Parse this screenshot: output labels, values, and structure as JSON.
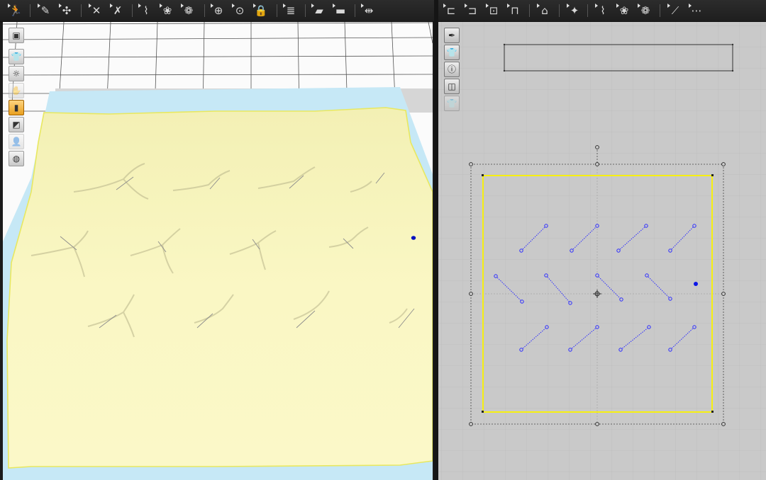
{
  "toolbar_left": {
    "tools": [
      {
        "name": "simulation-icon",
        "glyph": "🏃"
      },
      {
        "name": "select-mesh-icon",
        "glyph": "✎"
      },
      {
        "name": "pin-icon",
        "glyph": "✣"
      },
      {
        "name": "tack-icon",
        "glyph": "✕"
      },
      {
        "name": "tack-arrange-icon",
        "glyph": "✗"
      },
      {
        "name": "fold-icon",
        "glyph": "⌇"
      },
      {
        "name": "fold-arrange-icon",
        "glyph": "❀"
      },
      {
        "name": "shirt-fold-icon",
        "glyph": "❁"
      },
      {
        "name": "button-icon",
        "glyph": "⊕"
      },
      {
        "name": "buttonhole-icon",
        "glyph": "⊙"
      },
      {
        "name": "button-lock-icon",
        "glyph": "🔒"
      },
      {
        "name": "zipper-icon",
        "glyph": "≣"
      },
      {
        "name": "puckering-icon",
        "glyph": "▰"
      },
      {
        "name": "thickness-icon",
        "glyph": "▬"
      },
      {
        "name": "measure-icon",
        "glyph": "⇹"
      }
    ]
  },
  "toolbar_right": {
    "tools": [
      {
        "name": "seam-icon",
        "glyph": "⊏"
      },
      {
        "name": "segment-seam-icon",
        "glyph": "⊐"
      },
      {
        "name": "free-seam-icon",
        "glyph": "⊡"
      },
      {
        "name": "tack-on-avatar-icon",
        "glyph": "⊓"
      },
      {
        "name": "steam-iron-icon",
        "glyph": "⌂"
      },
      {
        "name": "topstitch-icon",
        "glyph": "✦"
      },
      {
        "name": "fold-pattern-icon",
        "glyph": "⌇"
      },
      {
        "name": "fold-arrange-2d-icon",
        "glyph": "❀"
      },
      {
        "name": "shirring-icon",
        "glyph": "❁"
      },
      {
        "name": "internal-line-icon",
        "glyph": "⟋"
      },
      {
        "name": "dart-line-icon",
        "glyph": "⋯"
      }
    ]
  },
  "view3d": {
    "tools": [
      {
        "name": "avatar-display-icon",
        "glyph": "▣",
        "active": false,
        "dimmed": false
      },
      {
        "name": "garment-display-icon",
        "glyph": "👕",
        "active": false,
        "dimmed": false
      },
      {
        "name": "pins-display-icon",
        "glyph": "☼",
        "active": false,
        "dimmed": false
      },
      {
        "name": "shading-icon",
        "glyph": "✋",
        "active": false,
        "dimmed": true
      },
      {
        "name": "texture-icon",
        "glyph": "▮",
        "active": true,
        "dimmed": false
      },
      {
        "name": "wireframe-icon",
        "glyph": "◩",
        "active": false,
        "dimmed": false
      },
      {
        "name": "avatar-silhouette-icon",
        "glyph": "👤",
        "active": false,
        "dimmed": true
      },
      {
        "name": "grid-globe-icon",
        "glyph": "◍",
        "active": false,
        "dimmed": false
      }
    ],
    "fabric_color": "#f9f6bf",
    "floor_color": "#c6e8f6",
    "outline_color": "#e8e860",
    "tack_lines": 14
  },
  "view2d": {
    "tools": [
      {
        "name": "brush-icon",
        "glyph": "✒",
        "dimmed": false
      },
      {
        "name": "pattern-display-icon",
        "glyph": "👕",
        "dimmed": false
      },
      {
        "name": "info-icon",
        "glyph": "ⓘ",
        "dimmed": false
      },
      {
        "name": "texture-2d-icon",
        "glyph": "◫",
        "dimmed": false
      },
      {
        "name": "lock-2d-icon",
        "glyph": "👕",
        "dimmed": true
      }
    ],
    "pattern_outline_color": "#f7f010",
    "tack_color": "#2b2bff",
    "tack_count": 14
  }
}
